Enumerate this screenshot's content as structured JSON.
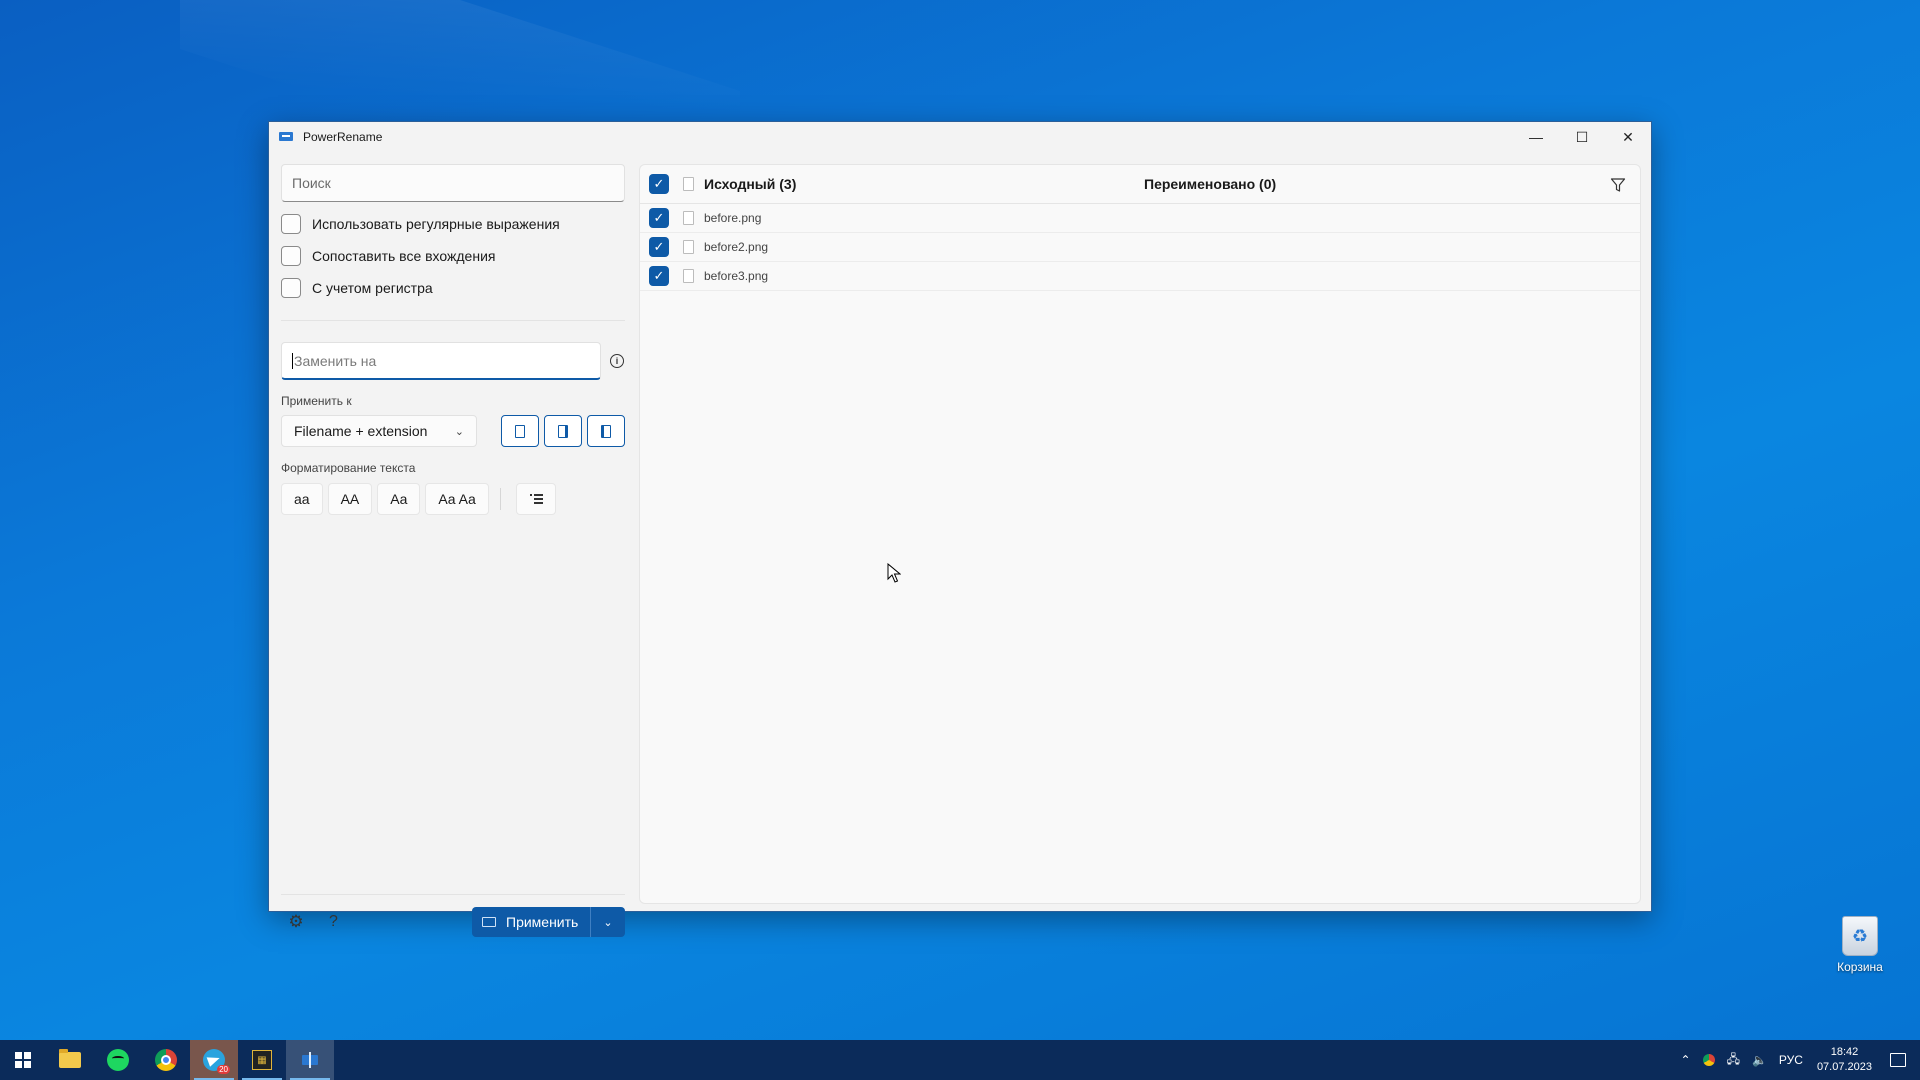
{
  "window": {
    "title": "PowerRename",
    "controls": {
      "minimize": "—",
      "maximize": "☐",
      "close": "✕"
    }
  },
  "search": {
    "placeholder": "Поиск"
  },
  "options": [
    {
      "label": "Использовать регулярные выражения",
      "checked": false
    },
    {
      "label": "Сопоставить все вхождения",
      "checked": false
    },
    {
      "label": "С учетом регистра",
      "checked": false
    }
  ],
  "replace": {
    "placeholder": "Заменить на"
  },
  "apply_to": {
    "label": "Применить к",
    "selected": "Filename + extension"
  },
  "text_formatting": {
    "label": "Форматирование текста",
    "buttons": [
      "aa",
      "AA",
      "Aa",
      "Aa Aa"
    ]
  },
  "footer": {
    "apply_label": "Применить"
  },
  "file_list": {
    "header_original": "Исходный (3)",
    "header_renamed": "Переименовано (0)",
    "items": [
      {
        "name": "before.png",
        "checked": true
      },
      {
        "name": "before2.png",
        "checked": true
      },
      {
        "name": "before3.png",
        "checked": true
      }
    ]
  },
  "desktop": {
    "recycle_bin_label": "Корзина"
  },
  "taskbar": {
    "telegram_badge": "20",
    "language": "РУС",
    "time": "18:42",
    "date": "07.07.2023"
  },
  "colors": {
    "accent": "#0e5aa7",
    "desktop": "#0a79d8",
    "taskbar": "#0b2b5a"
  }
}
